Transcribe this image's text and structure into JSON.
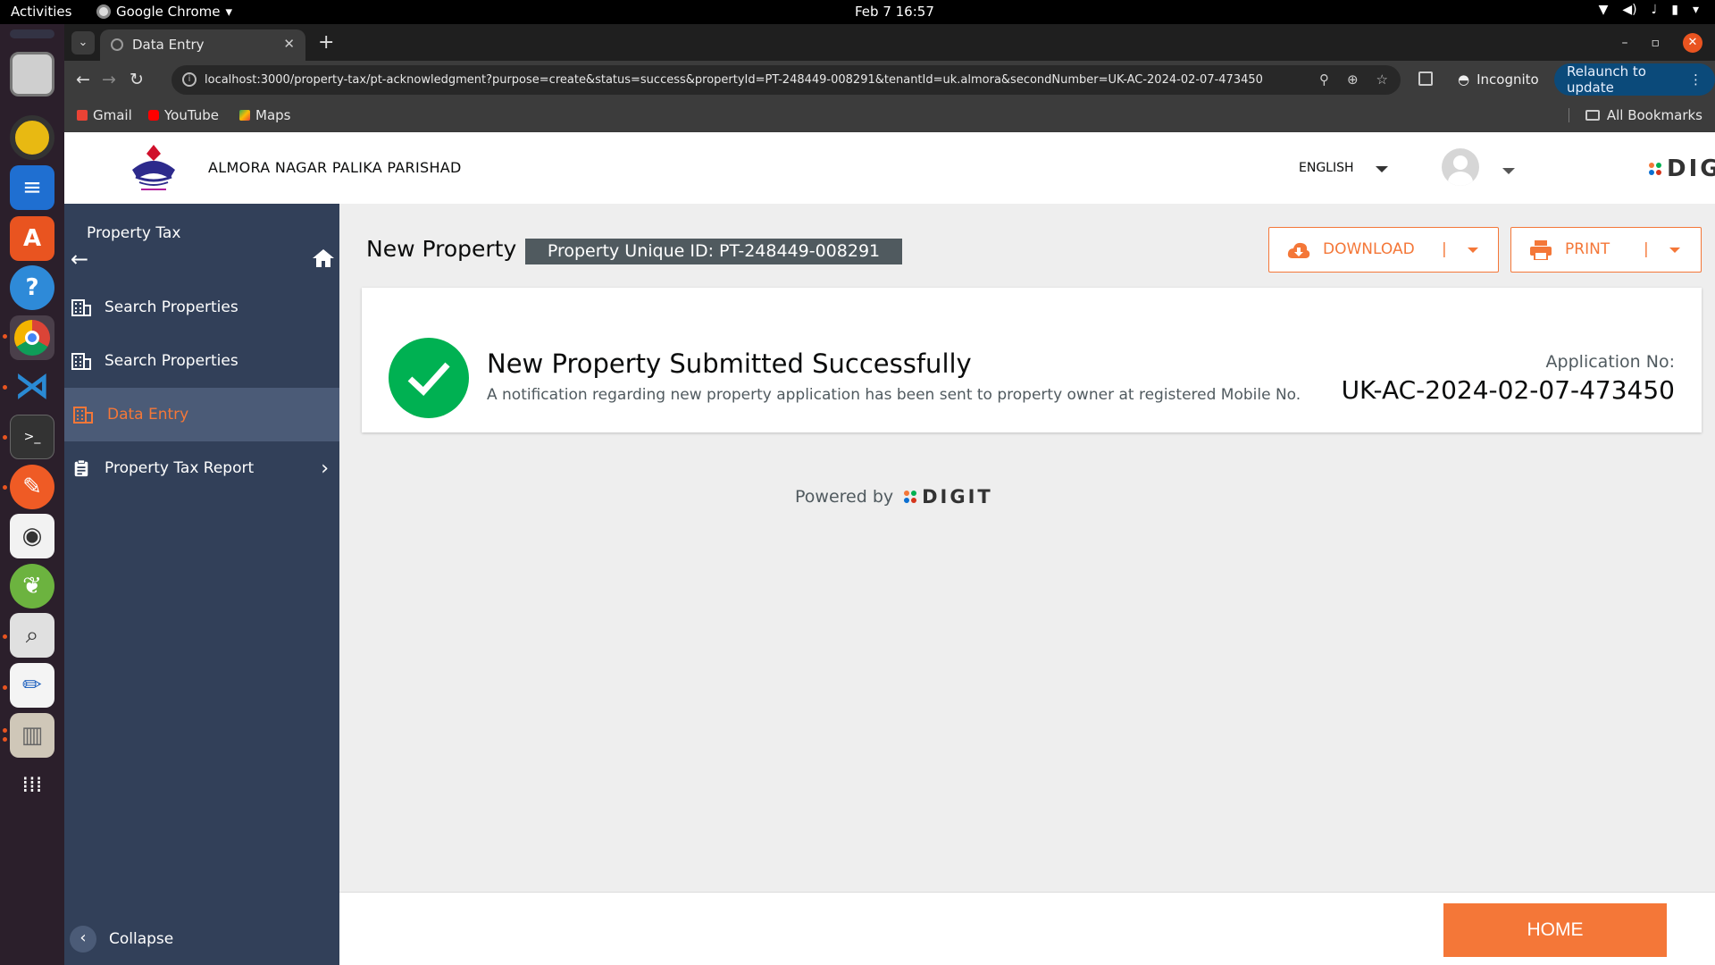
{
  "os": {
    "activities": "Activities",
    "app_name": "Google Chrome",
    "clock": "Feb 7  16:57"
  },
  "browser": {
    "tab_title": "Data Entry",
    "url": "localhost:3000/property-tax/pt-acknowledgment?purpose=create&status=success&propertyId=PT-248449-008291&tenantId=uk.almora&secondNumber=UK-AC-2024-02-07-473450",
    "incognito_label": "Incognito",
    "relaunch_label": "Relaunch to update",
    "bookmarks": [
      "Gmail",
      "YouTube",
      "Maps"
    ],
    "all_bookmarks": "All Bookmarks"
  },
  "header": {
    "city_name": "ALMORA NAGAR PALIKA PARISHAD",
    "language": "ENGLISH",
    "brand": "DIGIT"
  },
  "sidebar": {
    "module_title": "Property Tax",
    "items": [
      {
        "label": "Search Properties",
        "icon": "building-icon"
      },
      {
        "label": "Search Properties",
        "icon": "building-icon"
      },
      {
        "label": "Data Entry",
        "icon": "building-icon",
        "active": true
      },
      {
        "label": "Property Tax Report",
        "icon": "clipboard-icon"
      }
    ],
    "collapse_label": "Collapse"
  },
  "main": {
    "page_title": "New Property",
    "property_uid": "Property Unique ID: PT-248449-008291",
    "download_label": "DOWNLOAD",
    "print_label": "PRINT",
    "success_title": "New Property Submitted Successfully",
    "success_message": "A notification regarding new property application has been sent to property owner at registered Mobile No.",
    "application_label": "Application No:",
    "application_no": "UK-AC-2024-02-07-473450",
    "powered_by": "Powered by",
    "powered_brand": "DIGIT",
    "home_label": "HOME"
  },
  "colors": {
    "accent": "#f47738",
    "sidebar_bg": "#324059",
    "success": "#00b152"
  }
}
